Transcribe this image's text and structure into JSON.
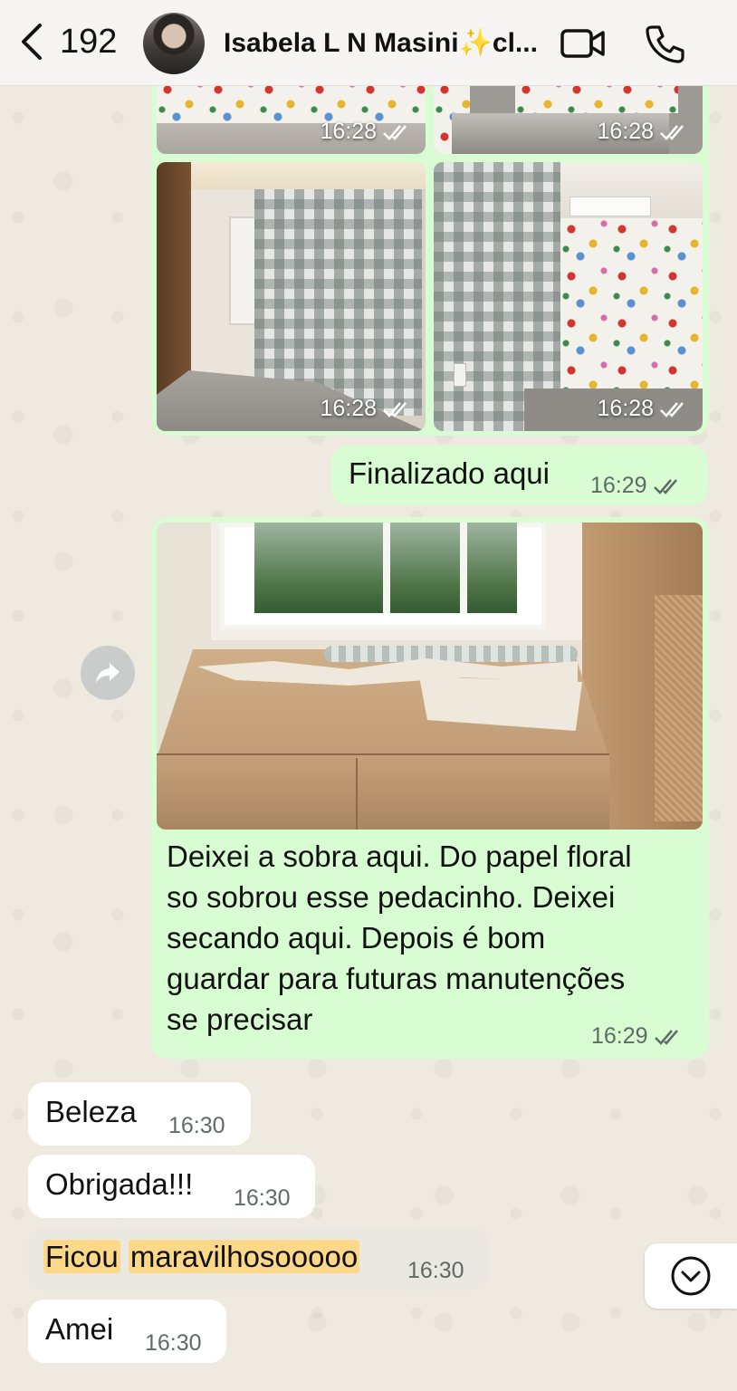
{
  "header": {
    "back_count": "192",
    "contact_name": "Isabela L N Masini✨cl...",
    "icons": [
      "chevron-left-icon",
      "video-camera-icon",
      "phone-icon"
    ]
  },
  "media": {
    "photo_times": [
      "16:28",
      "16:28",
      "16:28",
      "16:28"
    ],
    "read_receipt": "double-check-icon"
  },
  "messages": {
    "finalizado": {
      "text": "Finalizado aqui",
      "time": "16:29"
    },
    "photo_caption": {
      "lines": [
        "Deixei a sobra aqui. Do papel floral",
        "so sobrou esse pedacinho. Deixei",
        "secando aqui. Depois é bom",
        "guardar para futuras manutenções",
        "se precisar"
      ],
      "time": "16:29"
    },
    "beleza": {
      "text": "Beleza",
      "time": "16:30"
    },
    "obrigada": {
      "text": "Obrigada!!!",
      "time": "16:30"
    },
    "ficou": {
      "word1": "Ficou",
      "word2": "maravilhosooooo",
      "time": "16:30"
    },
    "amei": {
      "text": "Amei",
      "time": "16:30"
    }
  },
  "colors": {
    "outgoing_bubble": "#d8fdd2",
    "incoming_bubble": "#ffffff",
    "highlight": "#fdd889"
  }
}
